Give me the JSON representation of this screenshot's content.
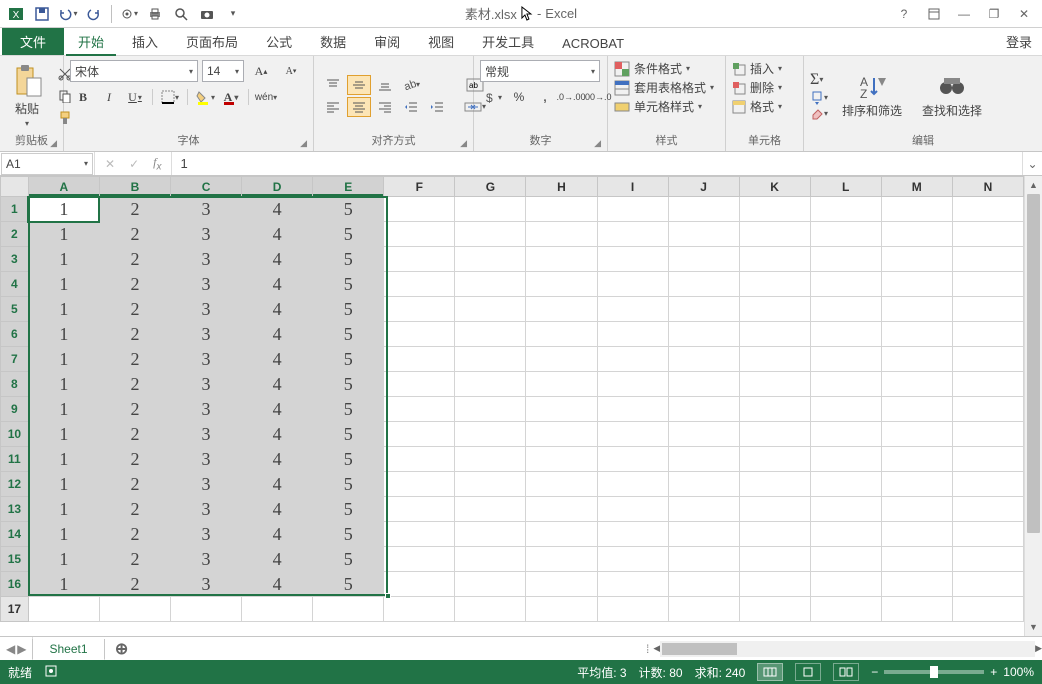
{
  "title": {
    "doc": "素材.xlsx",
    "app": "Excel"
  },
  "qat": [
    "save",
    "undo",
    "redo",
    "touch",
    "quickprint",
    "preview",
    "camera"
  ],
  "winbtns": {
    "help": "?",
    "full": "⬍",
    "min": "—",
    "restore": "❐",
    "close": "✕"
  },
  "tabs": {
    "file": "文件",
    "home": "开始",
    "insert": "插入",
    "layout": "页面布局",
    "formulas": "公式",
    "data": "数据",
    "review": "审阅",
    "view": "视图",
    "dev": "开发工具",
    "acrobat": "ACROBAT",
    "login": "登录"
  },
  "ribbon": {
    "clipboard": {
      "label": "剪贴板",
      "paste": "粘贴"
    },
    "font": {
      "label": "字体",
      "name": "宋体",
      "size": "14"
    },
    "align": {
      "label": "对齐方式"
    },
    "number": {
      "label": "数字",
      "format": "常规"
    },
    "styles": {
      "label": "样式",
      "cond": "条件格式",
      "tbl": "套用表格格式",
      "cell": "单元格样式"
    },
    "cells": {
      "label": "单元格",
      "insert": "插入",
      "delete": "删除",
      "format": "格式"
    },
    "editing": {
      "label": "编辑",
      "sort": "排序和筛选",
      "find": "查找和选择"
    }
  },
  "namebox": "A1",
  "formula": "1",
  "columns": [
    "A",
    "B",
    "C",
    "D",
    "E",
    "F",
    "G",
    "H",
    "I",
    "J",
    "K",
    "L",
    "M",
    "N"
  ],
  "selcols": 5,
  "rows": 17,
  "selrows": 16,
  "rowdata": [
    "1",
    "2",
    "3",
    "4",
    "5"
  ],
  "sheet": {
    "name": "Sheet1"
  },
  "status": {
    "ready": "就绪",
    "avg": "平均值: 3",
    "count": "计数: 80",
    "sum": "求和: 240",
    "zoom": "100%"
  }
}
